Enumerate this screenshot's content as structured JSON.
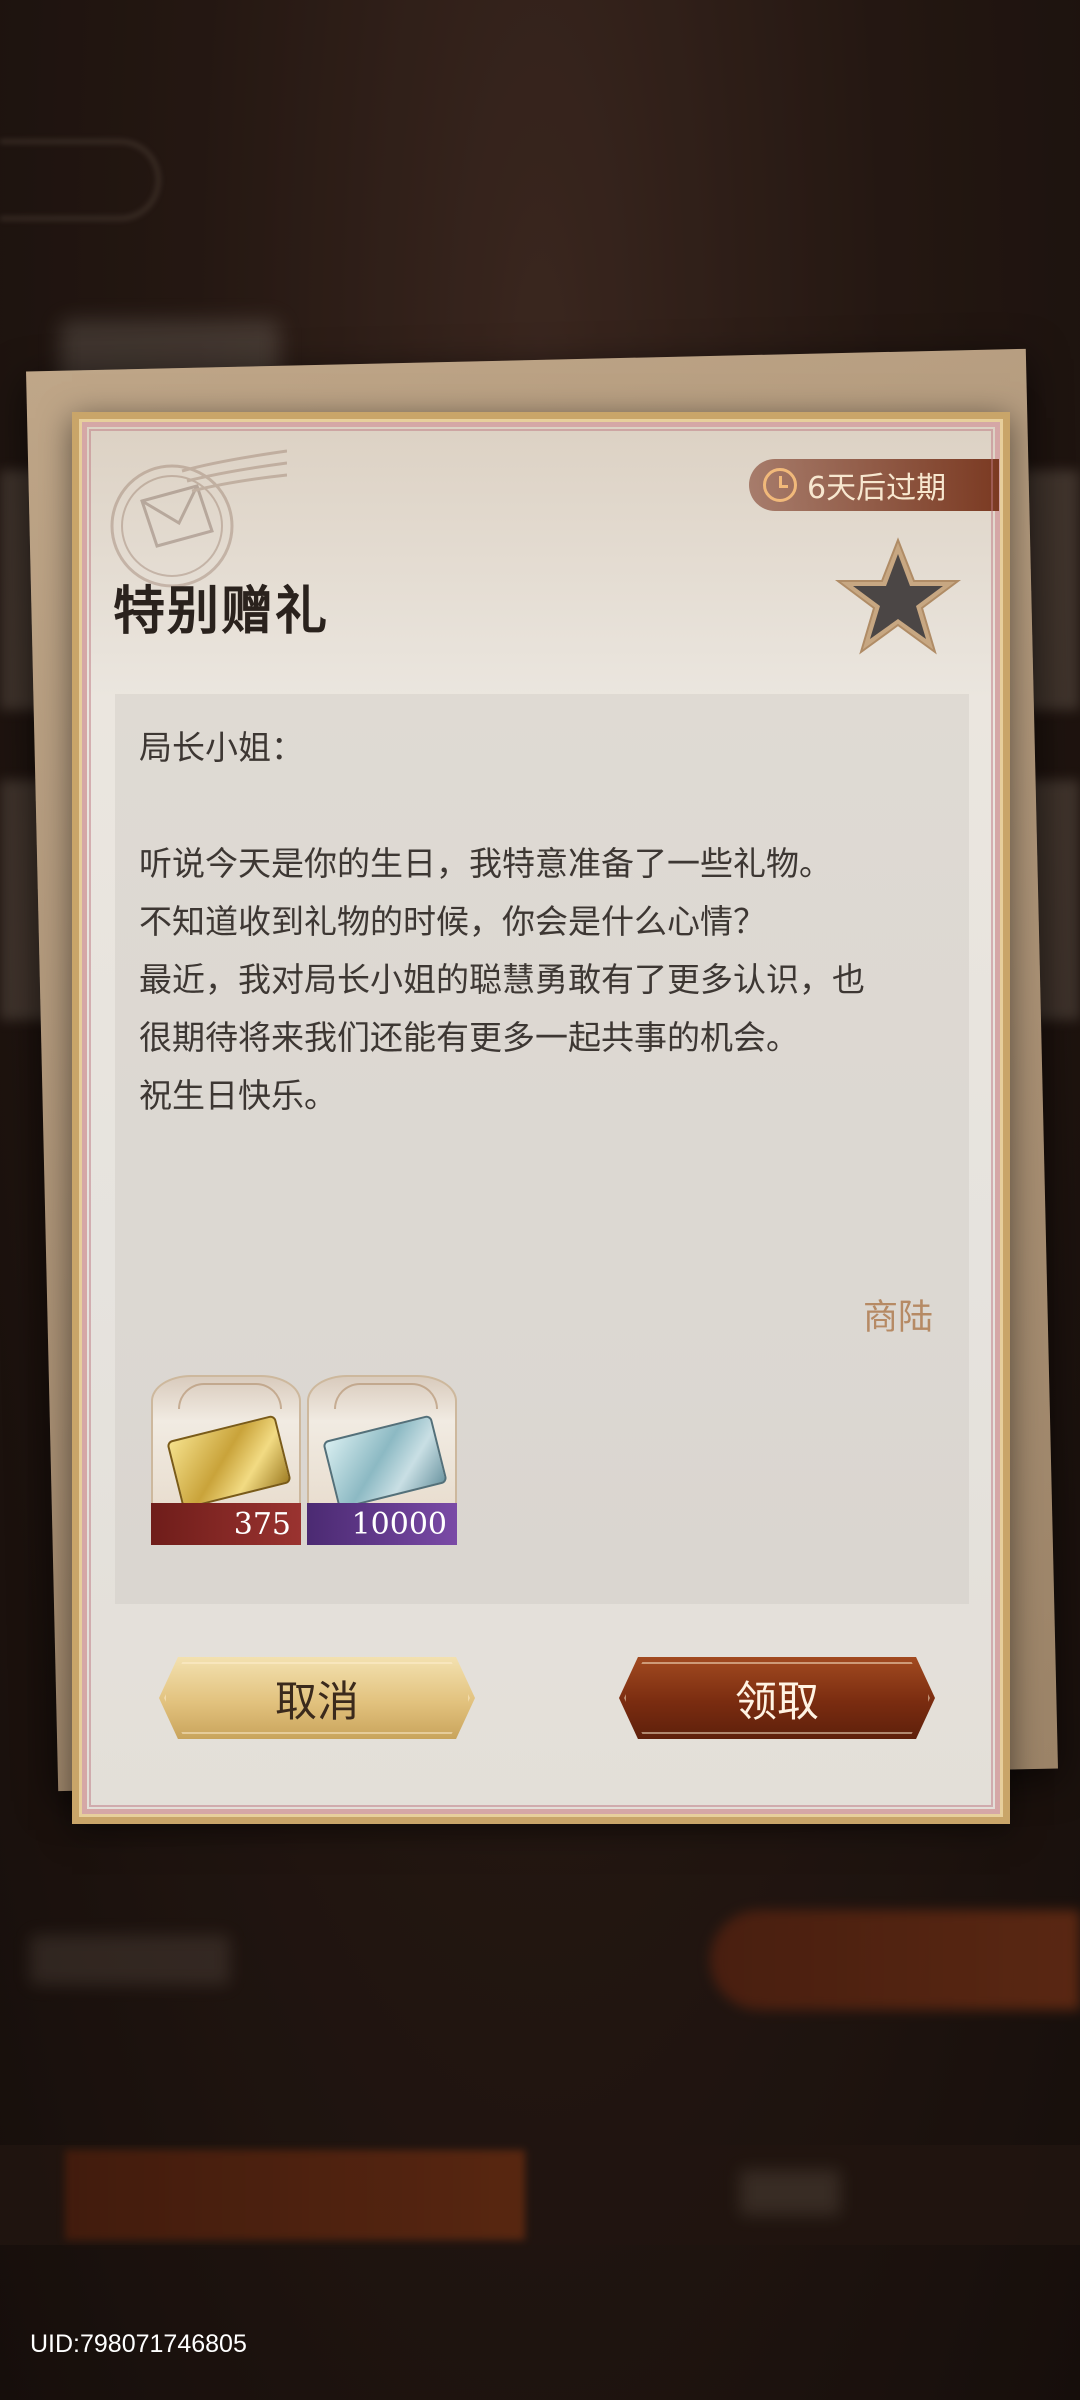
{
  "letter": {
    "expire_text": "6天后过期",
    "title": "特别赠礼",
    "lines": [
      "局长小姐：",
      "",
      "听说今天是你的生日，我特意准备了一些礼物。",
      "不知道收到礼物的时候，你会是什么心情？",
      "最近，我对局长小姐的聪慧勇敢有了更多认识，也",
      "很期待将来我们还能有更多一起共事的机会。",
      "祝生日快乐。"
    ],
    "signature": "商陆",
    "rewards": [
      {
        "icon": "gold-ticket-icon",
        "quantity": "375",
        "rarity_color": "#8b2a27"
      },
      {
        "icon": "banknote-icon",
        "quantity": "10000",
        "rarity_color": "#5e3a8c"
      }
    ],
    "buttons": {
      "cancel_label": "取消",
      "claim_label": "领取"
    }
  },
  "footer": {
    "uid": "UID:798071746805"
  },
  "colors": {
    "accent_gold": "#c9a569",
    "claim_button": "#7a2c10",
    "signature": "#b68a64"
  }
}
